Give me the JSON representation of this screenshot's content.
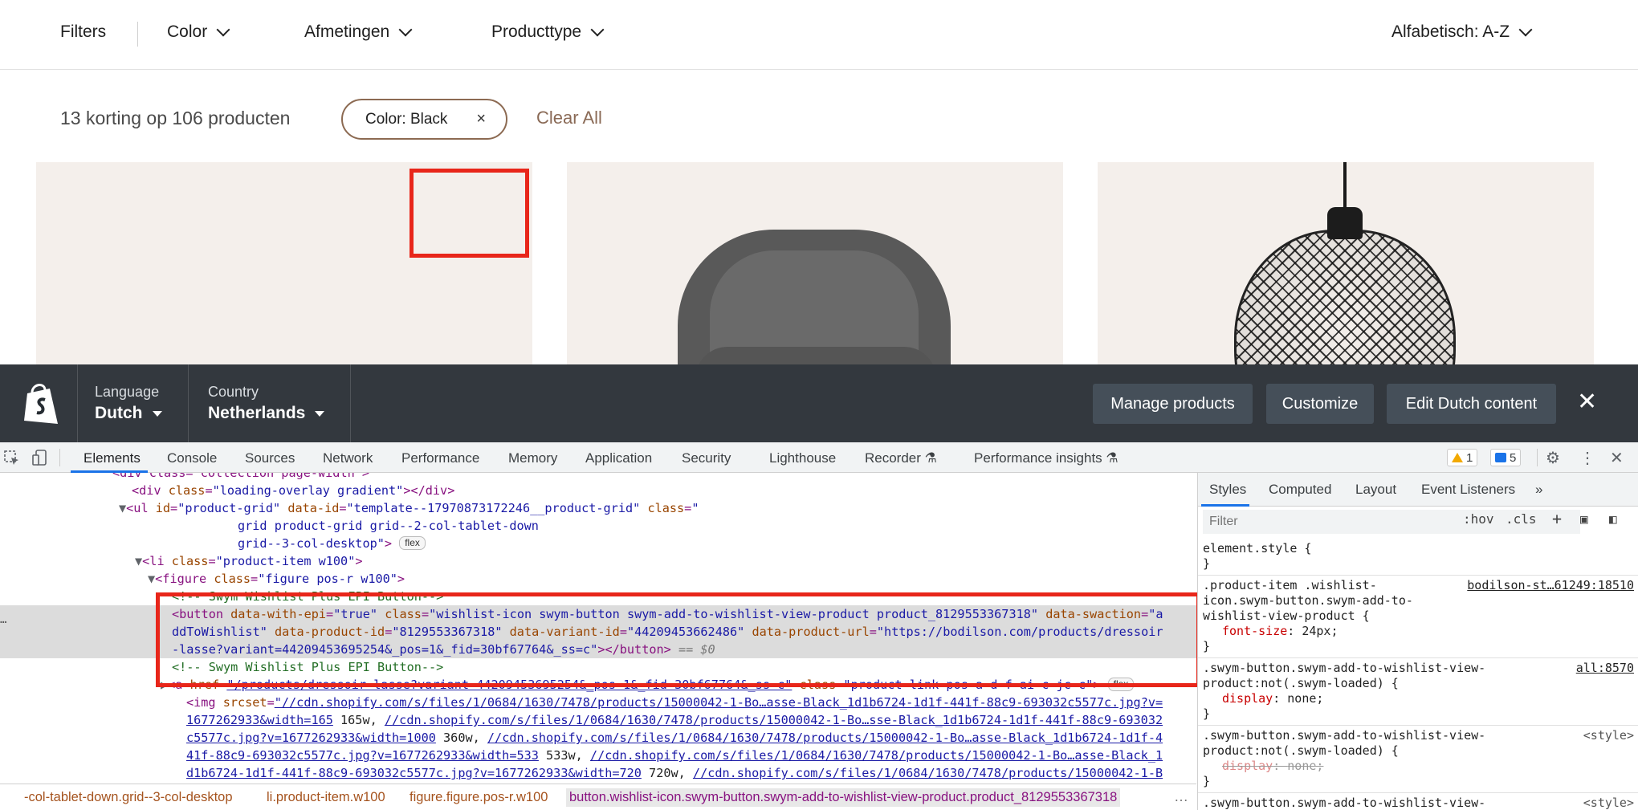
{
  "filter_bar": {
    "filters_label": "Filters",
    "color_label": "Color",
    "dimensions_label": "Afmetingen",
    "product_type_label": "Producttype",
    "sort_label": "Alfabetisch: A-Z"
  },
  "results": {
    "count_text": "13 korting op 106 producten",
    "active_chip": "Color: Black",
    "chip_remove": "×",
    "clear_all": "Clear All"
  },
  "admin_bar": {
    "language_label": "Language",
    "language_value": "Dutch",
    "country_label": "Country",
    "country_value": "Netherlands",
    "manage_products": "Manage products",
    "customize": "Customize",
    "edit_content": "Edit Dutch content",
    "close": "✕"
  },
  "devtools": {
    "tabs": [
      "Elements",
      "Console",
      "Sources",
      "Network",
      "Performance",
      "Memory",
      "Application",
      "Security",
      "Lighthouse",
      "Recorder",
      "Performance insights"
    ],
    "warnings_count": "1",
    "messages_count": "5",
    "dom": {
      "l0": "<div class=\"collection page-width\">",
      "l1_tag": "<div ",
      "l1_attr": "class",
      "l1_val": "\"loading-overlay gradient\"",
      "l1_end": "></div>",
      "l2_id": "\"product-grid\"",
      "l2_dataid": "\"template--17970873172246__product-grid\"",
      "l2_class_a": "\"",
      "l2_class_b": "grid product-grid grid--2-col-tablet-down",
      "l2_class_c": "grid--3-col-desktop\"",
      "flex": "flex",
      "l3_class": "\"product-item w100\"",
      "l4_class": "\"figure pos-r w100\"",
      "comment": "<!-- Swym Wishlist Plus EPI Button-->",
      "btn_epi": "\"true\"",
      "btn_class": "\"wishlist-icon swym-button swym-add-to-wishlist-view-product product_8129553367318\"",
      "btn_swaction_a": "\"a",
      "btn_swaction_b": "ddToWishlist\"",
      "btn_pid": "\"8129553367318\"",
      "btn_vid": "\"44209453662486\"",
      "btn_url_a": "\"https://bodilson.com/products/dressoir",
      "btn_url_b": "-lasse?variant=44209453695254&_pos=1&_fid=30bf67764&_ss=c\"",
      "eq0": "== $0",
      "a_href": "\"/products/dressoir-lasse?variant=44209453695254&_pos=1&_fid=30bf67764&_ss=c\"",
      "a_class": "\"product-link pos-a d-f ai-c jc-c\"",
      "img_1": "\"//cdn.shopify.com/s/files/1/0684/1630/7478/products/15000042-1-Bo…asse-Black_1d1b6724-1d1f-441f-88c9-693032c5577c.jpg?v=",
      "img_2": "1677262933&width=165",
      "img_2b": " 165w, ",
      "img_2c": "//cdn.shopify.com/s/files/1/0684/1630/7478/products/15000042-1-Bo…sse-Black_1d1b6724-1d1f-441f-88c9-693032",
      "img_3": "c5577c.jpg?v=1677262933&width=1000",
      "img_3b": " 360w, ",
      "img_3c": "//cdn.shopify.com/s/files/1/0684/1630/7478/products/15000042-1-Bo…asse-Black_1d1b6724-1d1f-4",
      "img_4": "41f-88c9-693032c5577c.jpg?v=1677262933&width=533",
      "img_4b": " 533w, ",
      "img_4c": "//cdn.shopify.com/s/files/1/0684/1630/7478/products/15000042-1-Bo…asse-Black_1",
      "img_5": "d1b6724-1d1f-441f-88c9-693032c5577c.jpg?v=1677262933&width=720",
      "img_5b": " 720w, ",
      "img_5c": "//cdn.shopify.com/s/files/1/0684/1630/7478/products/15000042-1-B"
    },
    "styles_panel": {
      "tabs": [
        "Styles",
        "Computed",
        "Layout",
        "Event Listeners"
      ],
      "more": "»",
      "filter_placeholder": "Filter",
      "hov": ":hov",
      "cls": ".cls",
      "plus": "+",
      "element_style": "element.style {",
      "close_brace": "}",
      "rule1_selector": ".product-item .wishlist-\nicon.swym-button.swym-add-to-\nwishlist-view-product {",
      "rule1_source": "bodilson-st…61249:18510",
      "rule1_prop": "font-size",
      "rule1_val": "24px;",
      "rule2_selector": ".swym-button.swym-add-to-wishlist-view-\nproduct:not(.swym-loaded) {",
      "rule2_source": "all:8570",
      "rule2_prop": "display",
      "rule2_val": "none;",
      "rule3_selector": ".swym-button.swym-add-to-wishlist-view-\nproduct:not(.swym-loaded) {",
      "rule3_source": "<style>",
      "rule3_prop": "display",
      "rule3_val": "none;",
      "rule4_selector": ".swym-button.swym-add-to-wishlist-view-",
      "rule4_source": "<style>"
    },
    "breadcrumbs": {
      "c1": "-col-tablet-down.grid--3-col-desktop",
      "c2": "li.product-item.w100",
      "c3": "figure.figure.pos-r.w100",
      "c4": "button.wishlist-icon.swym-button.swym-add-to-wishlist-view-product.product_8129553367318",
      "more": "…"
    },
    "side_dots": "…"
  },
  "colors": {
    "highlight": "#e8261a",
    "chip_border": "#8c6a52",
    "clear_all": "#8a6a56",
    "admin_bg": "#262c32",
    "devtools_accent": "#1a73e8"
  }
}
